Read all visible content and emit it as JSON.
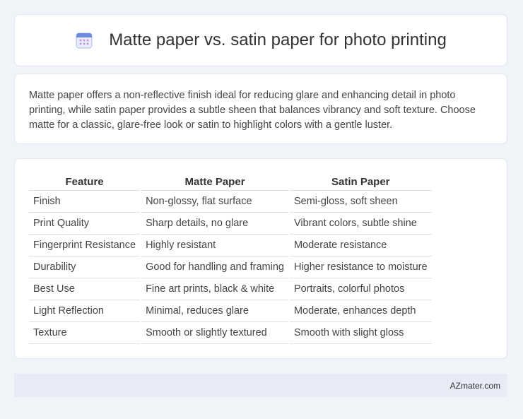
{
  "header": {
    "icon": "calendar-icon",
    "title": "Matte paper vs. satin paper for photo printing"
  },
  "intro": {
    "text": "Matte paper offers a non-reflective finish ideal for reducing glare and enhancing detail in photo printing, while satin paper provides a subtle sheen that balances vibrancy and soft texture. Choose matte for a classic, glare-free look or satin to highlight colors with a gentle luster."
  },
  "table": {
    "headers": [
      "Feature",
      "Matte Paper",
      "Satin Paper"
    ],
    "rows": [
      [
        "Finish",
        "Non-glossy, flat surface",
        "Semi-gloss, soft sheen"
      ],
      [
        "Print Quality",
        "Sharp details, no glare",
        "Vibrant colors, subtle shine"
      ],
      [
        "Fingerprint Resistance",
        "Highly resistant",
        "Moderate resistance"
      ],
      [
        "Durability",
        "Good for handling and framing",
        "Higher resistance to moisture"
      ],
      [
        "Best Use",
        "Fine art prints, black & white",
        "Portraits, colorful photos"
      ],
      [
        "Light Reflection",
        "Minimal, reduces glare",
        "Moderate, enhances depth"
      ],
      [
        "Texture",
        "Smooth or slightly textured",
        "Smooth with slight gloss"
      ]
    ]
  },
  "footer": {
    "brand": "AZmater.com"
  },
  "colors": {
    "background": "#f0f3f8",
    "icon_accent": "#6a8be0",
    "footer_bg": "#e6ebf5"
  }
}
